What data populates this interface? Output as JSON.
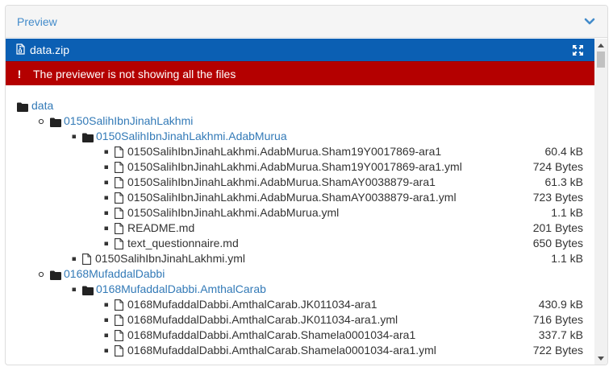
{
  "panel": {
    "title": "Preview"
  },
  "file": {
    "name": "data.zip"
  },
  "alert": {
    "symbol": "!",
    "message": "The previewer is not showing all the files"
  },
  "tree": {
    "root": {
      "label": "data"
    },
    "folder1": {
      "label": "0150SalihIbnJinahLakhmi",
      "sub": {
        "label": "0150SalihIbnJinahLakhmi.AdabMurua",
        "files": [
          {
            "name": "0150SalihIbnJinahLakhmi.AdabMurua.Sham19Y0017869-ara1",
            "size": "60.4 kB"
          },
          {
            "name": "0150SalihIbnJinahLakhmi.AdabMurua.Sham19Y0017869-ara1.yml",
            "size": "724 Bytes"
          },
          {
            "name": "0150SalihIbnJinahLakhmi.AdabMurua.ShamAY0038879-ara1",
            "size": "61.3 kB"
          },
          {
            "name": "0150SalihIbnJinahLakhmi.AdabMurua.ShamAY0038879-ara1.yml",
            "size": "723 Bytes"
          },
          {
            "name": "0150SalihIbnJinahLakhmi.AdabMurua.yml",
            "size": "1.1 kB"
          },
          {
            "name": "README.md",
            "size": "201 Bytes"
          },
          {
            "name": "text_questionnaire.md",
            "size": "650 Bytes"
          }
        ]
      },
      "files": [
        {
          "name": "0150SalihIbnJinahLakhmi.yml",
          "size": "1.1 kB"
        }
      ]
    },
    "folder2": {
      "label": "0168MufaddalDabbi",
      "sub": {
        "label": "0168MufaddalDabbi.AmthalCarab",
        "files": [
          {
            "name": "0168MufaddalDabbi.AmthalCarab.JK011034-ara1",
            "size": "430.9 kB"
          },
          {
            "name": "0168MufaddalDabbi.AmthalCarab.JK011034-ara1.yml",
            "size": "716 Bytes"
          },
          {
            "name": "0168MufaddalDabbi.AmthalCarab.Shamela0001034-ara1",
            "size": "337.7 kB"
          },
          {
            "name": "0168MufaddalDabbi.AmthalCarab.Shamela0001034-ara1.yml",
            "size": "722 Bytes"
          }
        ]
      }
    }
  },
  "colors": {
    "link": "#337ab7",
    "filebar": "#0b5fb3",
    "alert": "#b40000"
  }
}
